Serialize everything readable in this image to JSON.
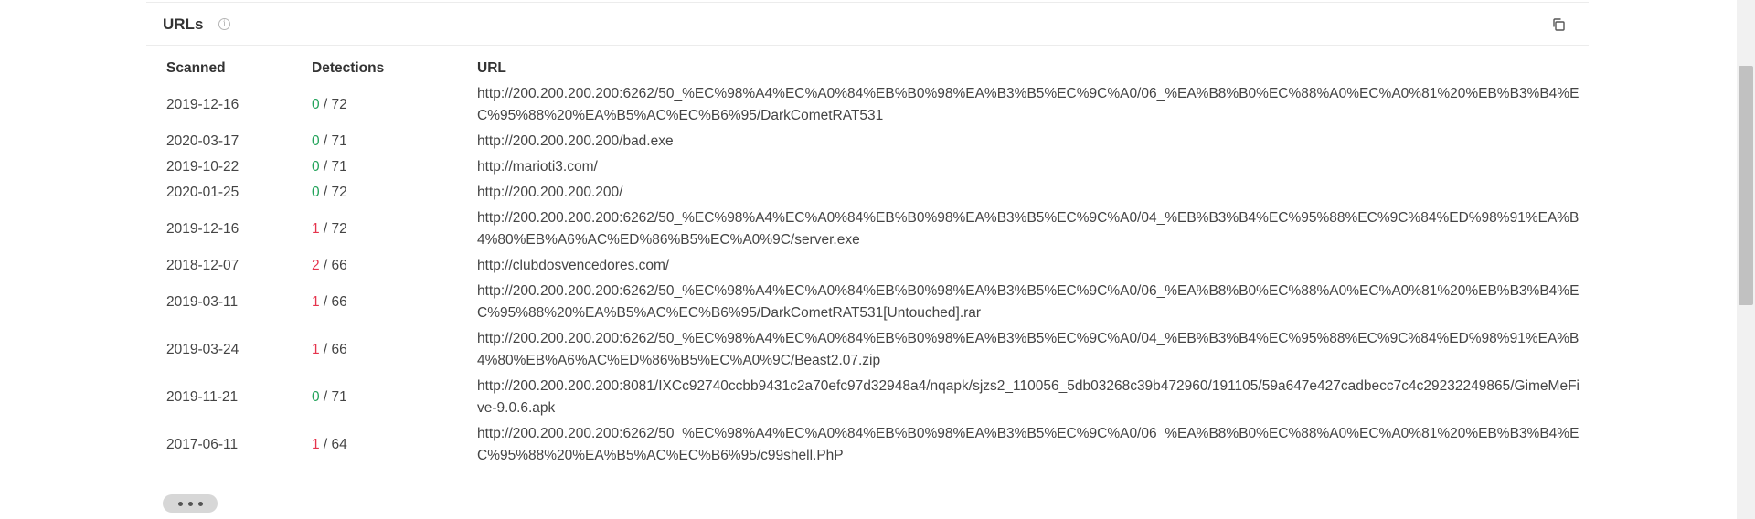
{
  "section": {
    "title": "URLs",
    "info_icon": "info-icon",
    "copy_icon": "copy-icon"
  },
  "table": {
    "headers": {
      "scanned": "Scanned",
      "detections": "Detections",
      "url": "URL"
    },
    "rows": [
      {
        "scanned": "2019-12-16",
        "positives": "0",
        "total": "72",
        "url": "http://200.200.200.200:6262/50_%EC%98%A4%EC%A0%84%EB%B0%98%EA%B3%B5%EC%9C%A0/06_%EA%B8%B0%EC%88%A0%EC%A0%81%20%EB%B3%B4%EC%95%88%20%EA%B5%AC%EC%B6%95/DarkCometRAT531"
      },
      {
        "scanned": "2020-03-17",
        "positives": "0",
        "total": "71",
        "url": "http://200.200.200.200/bad.exe"
      },
      {
        "scanned": "2019-10-22",
        "positives": "0",
        "total": "71",
        "url": "http://marioti3.com/"
      },
      {
        "scanned": "2020-01-25",
        "positives": "0",
        "total": "72",
        "url": "http://200.200.200.200/"
      },
      {
        "scanned": "2019-12-16",
        "positives": "1",
        "total": "72",
        "url": "http://200.200.200.200:6262/50_%EC%98%A4%EC%A0%84%EB%B0%98%EA%B3%B5%EC%9C%A0/04_%EB%B3%B4%EC%95%88%EC%9C%84%ED%98%91%EA%B4%80%EB%A6%AC%ED%86%B5%EC%A0%9C/server.exe"
      },
      {
        "scanned": "2018-12-07",
        "positives": "2",
        "total": "66",
        "url": "http://clubdosvencedores.com/"
      },
      {
        "scanned": "2019-03-11",
        "positives": "1",
        "total": "66",
        "url": "http://200.200.200.200:6262/50_%EC%98%A4%EC%A0%84%EB%B0%98%EA%B3%B5%EC%9C%A0/06_%EA%B8%B0%EC%88%A0%EC%A0%81%20%EB%B3%B4%EC%95%88%20%EA%B5%AC%EC%B6%95/DarkCometRAT531[Untouched].rar"
      },
      {
        "scanned": "2019-03-24",
        "positives": "1",
        "total": "66",
        "url": "http://200.200.200.200:6262/50_%EC%98%A4%EC%A0%84%EB%B0%98%EA%B3%B5%EC%9C%A0/04_%EB%B3%B4%EC%95%88%EC%9C%84%ED%98%91%EA%B4%80%EB%A6%AC%ED%86%B5%EC%A0%9C/Beast2.07.zip"
      },
      {
        "scanned": "2019-11-21",
        "positives": "0",
        "total": "71",
        "url": "http://200.200.200.200:8081/IXCc92740ccbb9431c2a70efc97d32948a4/nqapk/sjzs2_110056_5db03268c39b472960/191105/59a647e427cadbecc7c4c29232249865/GimeMeFive-9.0.6.apk"
      },
      {
        "scanned": "2017-06-11",
        "positives": "1",
        "total": "64",
        "url": "http://200.200.200.200:6262/50_%EC%98%A4%EC%A0%84%EB%B0%98%EA%B3%B5%EC%9C%A0/06_%EA%B8%B0%EC%88%A0%EC%A0%81%20%EB%B3%B4%EC%95%88%20%EA%B5%AC%EC%B6%95/c99shell.PhP"
      }
    ]
  },
  "more_button": {
    "icon": "more-dots-icon"
  },
  "colors": {
    "positive": "#e5344d",
    "zero": "#22a35a"
  }
}
